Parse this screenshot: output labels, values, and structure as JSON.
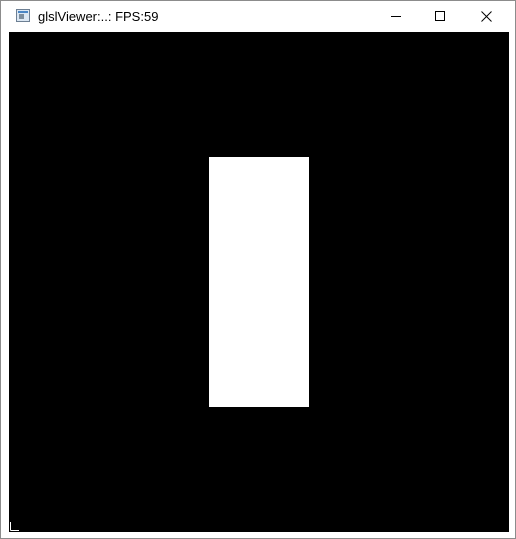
{
  "window": {
    "title": "glslViewer:..: FPS:59",
    "icon": "app-window-icon"
  },
  "controls": {
    "minimize": "minimize-icon",
    "maximize": "maximize-icon",
    "close": "close-icon"
  },
  "canvas": {
    "background": "#000000",
    "shape_color": "#ffffff"
  }
}
